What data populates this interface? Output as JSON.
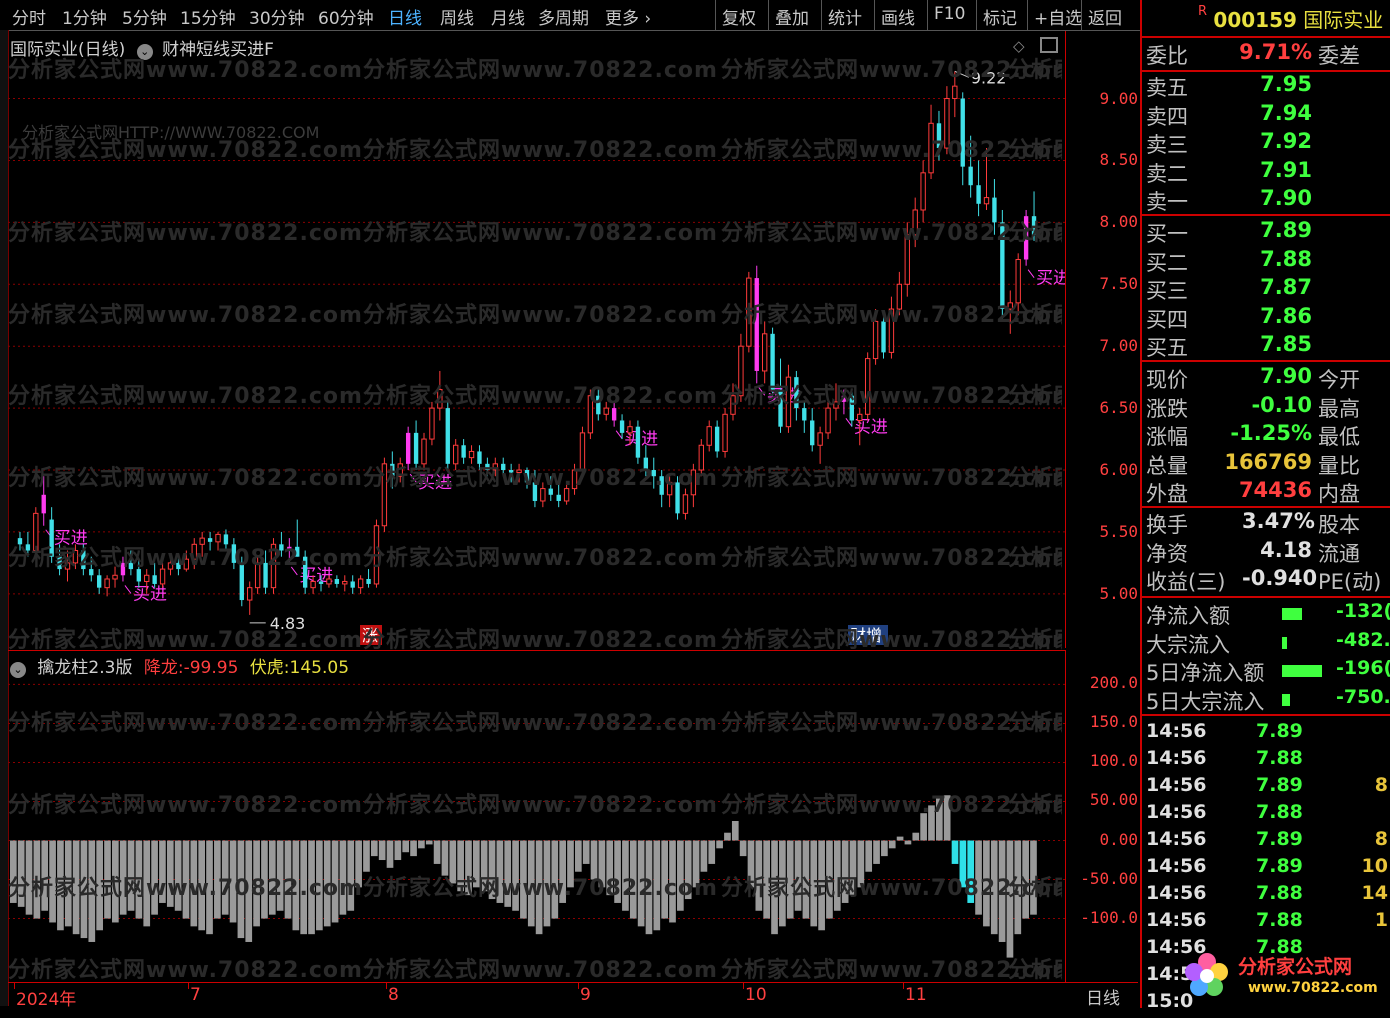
{
  "toolbar": {
    "periods": [
      "分时",
      "1分钟",
      "5分钟",
      "15分钟",
      "30分钟",
      "60分钟",
      "日线",
      "周线",
      "月线",
      "多周期",
      "更多 ›"
    ],
    "active": "日线",
    "tools": [
      "复权",
      "叠加",
      "统计",
      "画线",
      "F10",
      "标记",
      "+自选",
      "返回"
    ]
  },
  "main_chart": {
    "title": "国际实业(日线)",
    "indicator": "财神短线买进F",
    "watermark_url": "分析家公式网HTTP://WWW.70822.COM",
    "watermark": "分析家公式网www.70822.com",
    "high_label": "9.22",
    "low_label": "4.83",
    "buy_label": "买进",
    "event_labels": [
      "涨",
      "财增"
    ],
    "y_ticks": [
      "9.00",
      "8.50",
      "8.00",
      "7.50",
      "7.00",
      "6.50",
      "6.00",
      "5.50",
      "5.00"
    ]
  },
  "sub_chart": {
    "title": "擒龙柱2.3版",
    "series1_label": "降龙:",
    "series1_value": "-99.95",
    "series2_label": "伏虎:",
    "series2_value": "145.05",
    "y_ticks": [
      "200.0",
      "150.0",
      "100.0",
      "50.00",
      "0.00",
      "-50.00",
      "-100.0"
    ]
  },
  "time_axis": {
    "labels": [
      "2024年",
      "7",
      "8",
      "9",
      "10",
      "11"
    ],
    "period_label": "日线"
  },
  "quote": {
    "flag": "R",
    "code": "000159",
    "name": "国际实业",
    "weibi_label": "委比",
    "weibi_value": "9.71%",
    "weicha_label": "委差",
    "asks": [
      {
        "label": "卖五",
        "price": "7.95"
      },
      {
        "label": "卖四",
        "price": "7.94"
      },
      {
        "label": "卖三",
        "price": "7.92"
      },
      {
        "label": "卖二",
        "price": "7.91"
      },
      {
        "label": "卖一",
        "price": "7.90"
      }
    ],
    "bids": [
      {
        "label": "买一",
        "price": "7.89"
      },
      {
        "label": "买二",
        "price": "7.88"
      },
      {
        "label": "买三",
        "price": "7.87"
      },
      {
        "label": "买四",
        "price": "7.86"
      },
      {
        "label": "买五",
        "price": "7.85"
      }
    ],
    "stats": [
      {
        "label": "现价",
        "value": "7.90",
        "right": "今开",
        "color": "#3fff3f"
      },
      {
        "label": "涨跌",
        "value": "-0.10",
        "right": "最高",
        "color": "#3fff3f"
      },
      {
        "label": "涨幅",
        "value": "-1.25%",
        "right": "最低",
        "color": "#3fff3f"
      },
      {
        "label": "总量",
        "value": "166769",
        "right": "量比",
        "color": "#e8c43a"
      },
      {
        "label": "外盘",
        "value": "74436",
        "right": "内盘",
        "color": "#ff3f3f"
      }
    ],
    "stats2": [
      {
        "label": "换手",
        "value": "3.47%",
        "right": "股本"
      },
      {
        "label": "净资",
        "value": "4.18",
        "right": "流通"
      },
      {
        "label": "收益(三)",
        "value": "-0.940",
        "right": "PE(动)"
      }
    ],
    "flows": [
      {
        "label": "净流入额",
        "value": "-132(",
        "bar": 0.4
      },
      {
        "label": "大宗流入",
        "value": "-482.(",
        "bar": 0.1
      },
      {
        "label": "5日净流入额",
        "value": "-196(",
        "bar": 0.8
      },
      {
        "label": "5日大宗流入",
        "value": "-750.(",
        "bar": 0.15
      }
    ],
    "ticks": [
      {
        "time": "14:56",
        "price": "7.89",
        "vol": ""
      },
      {
        "time": "14:56",
        "price": "7.88",
        "vol": ""
      },
      {
        "time": "14:56",
        "price": "7.89",
        "vol": "8"
      },
      {
        "time": "14:56",
        "price": "7.88",
        "vol": ""
      },
      {
        "time": "14:56",
        "price": "7.89",
        "vol": "8"
      },
      {
        "time": "14:56",
        "price": "7.89",
        "vol": "10"
      },
      {
        "time": "14:56",
        "price": "7.88",
        "vol": "14"
      },
      {
        "time": "14:56",
        "price": "7.88",
        "vol": "1"
      },
      {
        "time": "14:56",
        "price": "7.88",
        "vol": ""
      },
      {
        "time": "14:5",
        "price": "",
        "vol": ""
      },
      {
        "time": "15:0",
        "price": "",
        "vol": ""
      }
    ],
    "logo_text": "分析家公式网",
    "logo_url": "www.70822.com"
  },
  "chart_data": {
    "type": "candlestick",
    "ylim": [
      4.7,
      9.4
    ],
    "candles": [
      [
        5.45,
        5.5,
        5.35,
        5.4
      ],
      [
        5.4,
        5.5,
        5.3,
        5.35
      ],
      [
        5.35,
        5.7,
        5.3,
        5.65
      ],
      [
        5.65,
        5.95,
        5.55,
        5.8
      ],
      [
        5.6,
        5.7,
        5.25,
        5.3
      ],
      [
        5.3,
        5.4,
        5.15,
        5.2
      ],
      [
        5.2,
        5.35,
        5.1,
        5.25
      ],
      [
        5.25,
        5.4,
        5.2,
        5.35
      ],
      [
        5.35,
        5.4,
        5.15,
        5.2
      ],
      [
        5.2,
        5.3,
        5.1,
        5.15
      ],
      [
        5.15,
        5.2,
        5.0,
        5.05
      ],
      [
        5.05,
        5.15,
        4.98,
        5.12
      ],
      [
        5.12,
        5.22,
        5.05,
        5.15
      ],
      [
        5.15,
        5.3,
        5.1,
        5.25
      ],
      [
        5.25,
        5.35,
        5.15,
        5.2
      ],
      [
        5.2,
        5.28,
        5.05,
        5.1
      ],
      [
        5.1,
        5.2,
        5.0,
        5.15
      ],
      [
        5.15,
        5.25,
        5.05,
        5.08
      ],
      [
        5.08,
        5.25,
        5.05,
        5.2
      ],
      [
        5.2,
        5.3,
        5.15,
        5.25
      ],
      [
        5.25,
        5.3,
        5.15,
        5.2
      ],
      [
        5.2,
        5.35,
        5.18,
        5.28
      ],
      [
        5.28,
        5.45,
        5.2,
        5.4
      ],
      [
        5.4,
        5.5,
        5.3,
        5.45
      ],
      [
        5.45,
        5.5,
        5.35,
        5.42
      ],
      [
        5.42,
        5.5,
        5.35,
        5.48
      ],
      [
        5.48,
        5.52,
        5.35,
        5.4
      ],
      [
        5.4,
        5.45,
        5.2,
        5.25
      ],
      [
        5.25,
        5.3,
        4.9,
        4.95
      ],
      [
        4.95,
        5.1,
        4.83,
        5.05
      ],
      [
        5.05,
        5.3,
        5.0,
        5.25
      ],
      [
        5.25,
        5.35,
        5.0,
        5.05
      ],
      [
        5.05,
        5.45,
        5.0,
        5.4
      ],
      [
        5.4,
        5.5,
        5.3,
        5.35
      ],
      [
        5.35,
        5.45,
        5.25,
        5.38
      ],
      [
        5.38,
        5.6,
        5.3,
        5.3
      ],
      [
        5.3,
        5.35,
        5.0,
        5.05
      ],
      [
        5.05,
        5.15,
        5.0,
        5.1
      ],
      [
        5.1,
        5.15,
        5.02,
        5.08
      ],
      [
        5.08,
        5.15,
        5.05,
        5.12
      ],
      [
        5.12,
        5.15,
        5.05,
        5.08
      ],
      [
        5.08,
        5.15,
        5.02,
        5.1
      ],
      [
        5.1,
        5.15,
        5.0,
        5.05
      ],
      [
        5.05,
        5.15,
        5.0,
        5.12
      ],
      [
        5.12,
        5.2,
        5.05,
        5.08
      ],
      [
        5.08,
        5.6,
        5.05,
        5.55
      ],
      [
        5.55,
        6.1,
        5.5,
        6.05
      ],
      [
        6.05,
        6.15,
        5.85,
        5.95
      ],
      [
        5.95,
        6.1,
        5.9,
        6.05
      ],
      [
        6.05,
        6.35,
        6.0,
        6.3
      ],
      [
        6.3,
        6.4,
        6.0,
        6.05
      ],
      [
        6.05,
        6.3,
        6.0,
        6.25
      ],
      [
        6.25,
        6.55,
        6.2,
        6.5
      ],
      [
        6.5,
        6.8,
        6.4,
        6.65
      ],
      [
        6.5,
        6.55,
        6.0,
        6.05
      ],
      [
        6.05,
        6.25,
        6.0,
        6.2
      ],
      [
        6.2,
        6.25,
        6.05,
        6.1
      ],
      [
        6.1,
        6.2,
        6.05,
        6.15
      ],
      [
        6.15,
        6.2,
        6.0,
        6.05
      ],
      [
        6.05,
        6.1,
        5.95,
        6.0
      ],
      [
        6.0,
        6.1,
        5.95,
        6.05
      ],
      [
        6.05,
        6.1,
        5.95,
        6.0
      ],
      [
        6.0,
        6.05,
        5.9,
        5.98
      ],
      [
        5.98,
        6.05,
        5.9,
        6.0
      ],
      [
        6.0,
        6.02,
        5.85,
        5.9
      ],
      [
        5.9,
        6.0,
        5.7,
        5.75
      ],
      [
        5.75,
        5.9,
        5.7,
        5.85
      ],
      [
        5.85,
        5.95,
        5.75,
        5.8
      ],
      [
        5.8,
        5.9,
        5.7,
        5.75
      ],
      [
        5.75,
        5.9,
        5.72,
        5.85
      ],
      [
        5.85,
        6.05,
        5.8,
        6.0
      ],
      [
        6.0,
        6.35,
        5.95,
        6.3
      ],
      [
        6.3,
        6.65,
        6.25,
        6.6
      ],
      [
        6.6,
        6.65,
        6.4,
        6.45
      ],
      [
        6.45,
        6.55,
        6.4,
        6.5
      ],
      [
        6.5,
        6.55,
        6.35,
        6.4
      ],
      [
        6.4,
        6.45,
        6.25,
        6.3
      ],
      [
        6.3,
        6.4,
        6.2,
        6.35
      ],
      [
        6.35,
        6.4,
        6.05,
        6.1
      ],
      [
        6.1,
        6.2,
        5.95,
        6.0
      ],
      [
        6.0,
        6.1,
        5.85,
        5.95
      ],
      [
        5.95,
        6.0,
        5.7,
        5.8
      ],
      [
        5.8,
        5.95,
        5.7,
        5.9
      ],
      [
        5.9,
        5.95,
        5.6,
        5.65
      ],
      [
        5.65,
        5.85,
        5.6,
        5.8
      ],
      [
        5.8,
        6.05,
        5.7,
        6.0
      ],
      [
        6.0,
        6.25,
        5.95,
        6.2
      ],
      [
        6.2,
        6.4,
        6.15,
        6.35
      ],
      [
        6.35,
        6.4,
        6.1,
        6.15
      ],
      [
        6.15,
        6.5,
        6.1,
        6.45
      ],
      [
        6.45,
        6.7,
        6.4,
        6.6
      ],
      [
        6.6,
        7.1,
        6.55,
        7.0
      ],
      [
        7.0,
        7.6,
        6.95,
        7.55
      ],
      [
        7.55,
        7.65,
        6.7,
        6.8
      ],
      [
        6.8,
        7.2,
        6.7,
        7.1
      ],
      [
        7.1,
        7.15,
        6.6,
        6.65
      ],
      [
        6.65,
        6.9,
        6.3,
        6.35
      ],
      [
        6.35,
        6.85,
        6.3,
        6.75
      ],
      [
        6.75,
        6.8,
        6.4,
        6.5
      ],
      [
        6.5,
        6.55,
        6.3,
        6.4
      ],
      [
        6.4,
        6.5,
        6.15,
        6.2
      ],
      [
        6.2,
        6.35,
        6.05,
        6.3
      ],
      [
        6.3,
        6.55,
        6.25,
        6.5
      ],
      [
        6.5,
        6.7,
        6.4,
        6.55
      ],
      [
        6.55,
        6.65,
        6.45,
        6.6
      ],
      [
        6.6,
        6.65,
        6.35,
        6.4
      ],
      [
        6.4,
        6.5,
        6.2,
        6.45
      ],
      [
        6.45,
        6.95,
        6.4,
        6.9
      ],
      [
        6.9,
        7.3,
        6.85,
        7.2
      ],
      [
        7.2,
        7.25,
        6.9,
        6.95
      ],
      [
        6.95,
        7.4,
        6.9,
        7.3
      ],
      [
        7.3,
        7.6,
        7.25,
        7.5
      ],
      [
        7.5,
        8.0,
        7.4,
        7.9
      ],
      [
        7.9,
        8.2,
        7.8,
        8.1
      ],
      [
        8.1,
        8.5,
        8.0,
        8.4
      ],
      [
        8.4,
        8.95,
        8.35,
        8.8
      ],
      [
        8.8,
        8.9,
        8.5,
        8.6
      ],
      [
        8.6,
        9.1,
        8.55,
        9.0
      ],
      [
        9.0,
        9.22,
        8.85,
        9.1
      ],
      [
        9.0,
        9.05,
        8.3,
        8.45
      ],
      [
        8.45,
        8.7,
        8.2,
        8.3
      ],
      [
        8.3,
        8.5,
        8.05,
        8.15
      ],
      [
        8.15,
        8.6,
        8.1,
        8.2
      ],
      [
        8.2,
        8.35,
        7.9,
        8.0
      ],
      [
        8.0,
        8.1,
        7.2,
        7.3
      ],
      [
        7.3,
        7.45,
        7.1,
        7.35
      ],
      [
        7.35,
        7.75,
        7.25,
        7.7
      ],
      [
        7.7,
        8.1,
        7.65,
        8.05
      ],
      [
        8.05,
        8.25,
        7.85,
        7.9
      ]
    ],
    "sub_values": [
      -80,
      -85,
      -95,
      -100,
      -90,
      -105,
      -115,
      -110,
      -120,
      -125,
      -130,
      -115,
      -100,
      -105,
      -95,
      -90,
      -100,
      -110,
      -95,
      -80,
      -85,
      -90,
      -100,
      -110,
      -115,
      -120,
      -100,
      -95,
      -105,
      -125,
      -130,
      -110,
      -100,
      -95,
      -90,
      -100,
      -115,
      -120,
      -120,
      -115,
      -110,
      -105,
      -95,
      -90,
      -60,
      -40,
      -20,
      -25,
      -35,
      -25,
      -15,
      -20,
      -10,
      -5,
      -30,
      -45,
      -55,
      -65,
      -70,
      -60,
      -65,
      -75,
      -80,
      -85,
      -90,
      -100,
      -110,
      -120,
      -110,
      -100,
      -80,
      -60,
      -40,
      -30,
      -50,
      -60,
      -70,
      -80,
      -90,
      -100,
      -110,
      -120,
      -115,
      -100,
      -105,
      -90,
      -75,
      -60,
      -40,
      -30,
      -10,
      10,
      25,
      -20,
      -60,
      -90,
      -100,
      -120,
      -110,
      -100,
      -90,
      -100,
      -110,
      -115,
      -100,
      -90,
      -80,
      -70,
      -60,
      -40,
      -30,
      -20,
      -10,
      5,
      -5,
      10,
      35,
      45,
      55,
      58,
      -30,
      -60,
      -80,
      -95,
      -110,
      -120,
      -130,
      -150,
      -120,
      -100,
      -95
    ],
    "buy_signal_indices": [
      3,
      13,
      34,
      49,
      75,
      93,
      104,
      127
    ]
  }
}
